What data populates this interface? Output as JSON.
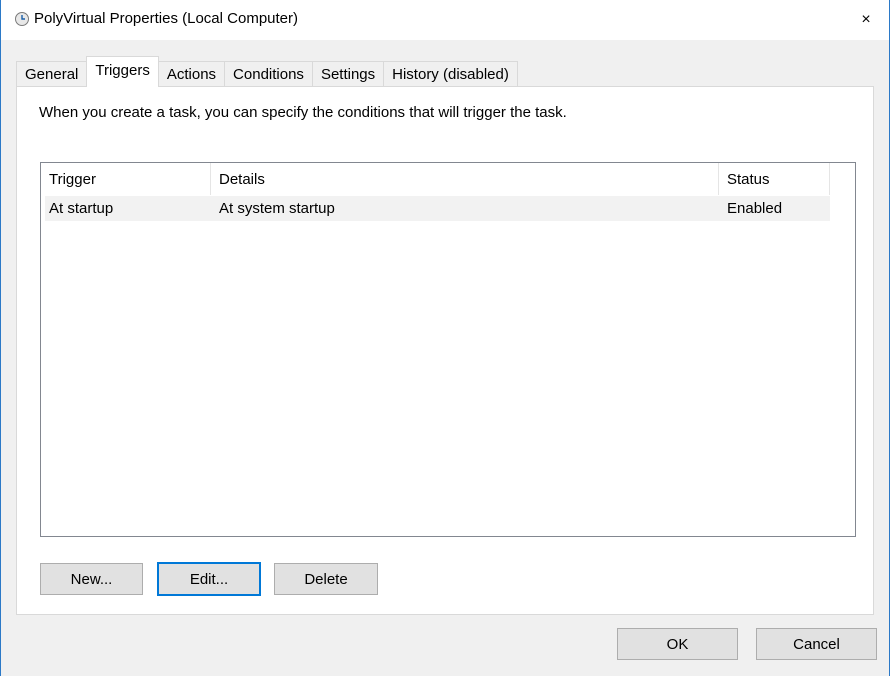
{
  "window": {
    "title": "PolyVirtual Properties (Local Computer)",
    "close_label": "×"
  },
  "tabs": [
    {
      "label": "General",
      "active": false
    },
    {
      "label": "Triggers",
      "active": true
    },
    {
      "label": "Actions",
      "active": false
    },
    {
      "label": "Conditions",
      "active": false
    },
    {
      "label": "Settings",
      "active": false
    },
    {
      "label": "History (disabled)",
      "active": false
    }
  ],
  "triggers_panel": {
    "description": "When you create a task, you can specify the conditions that will trigger the task.",
    "columns": [
      "Trigger",
      "Details",
      "Status"
    ],
    "rows": [
      {
        "trigger": "At startup",
        "details": "At system startup",
        "status": "Enabled"
      }
    ],
    "buttons": {
      "new_label": "New...",
      "edit_label": "Edit...",
      "delete_label": "Delete"
    }
  },
  "dialog_buttons": {
    "ok_label": "OK",
    "cancel_label": "Cancel"
  }
}
